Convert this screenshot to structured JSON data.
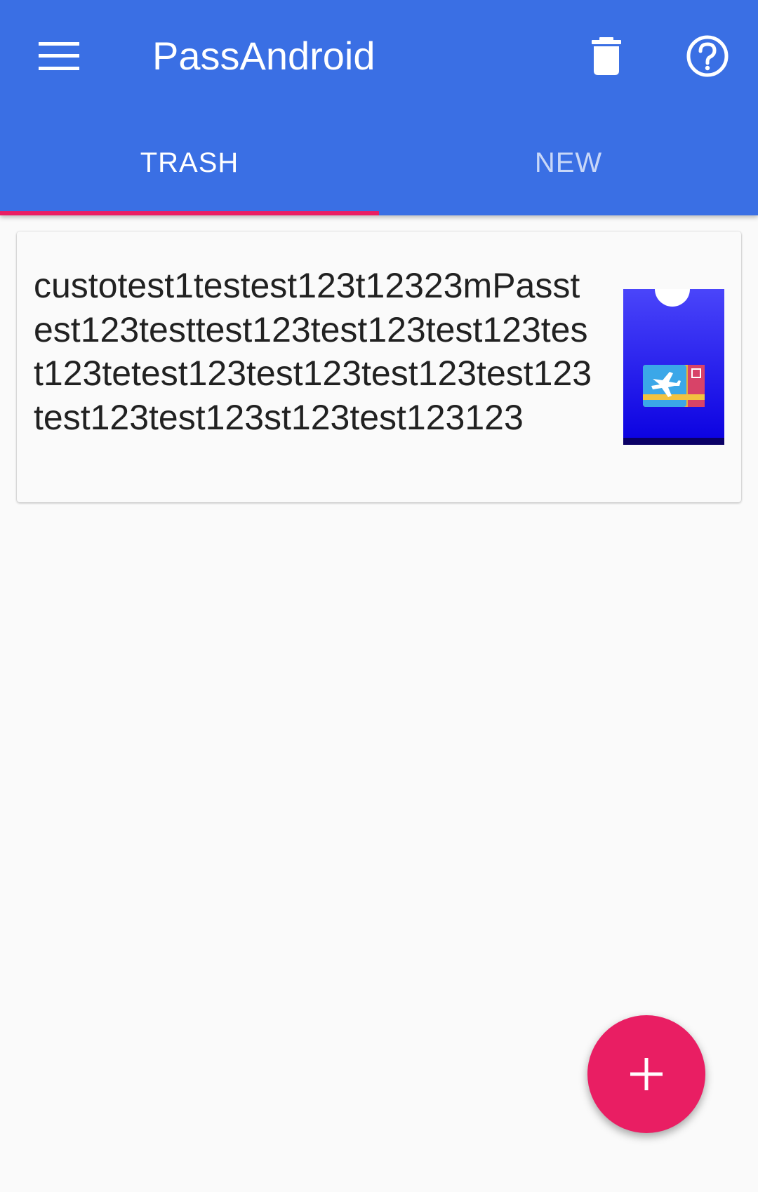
{
  "toolbar": {
    "title": "PassAndroid",
    "menu_icon": "menu-icon",
    "delete_icon": "trash-icon",
    "help_icon": "help-icon"
  },
  "tabs": [
    {
      "label": "TRASH",
      "active": true
    },
    {
      "label": "NEW",
      "active": false
    }
  ],
  "passes": [
    {
      "description": "custotest1testest123t12323mPasstest123testtest123test123test123test123tetest123test123test123test123test123test123st123test123123",
      "thumbnail_icon": "boarding-pass-icon"
    }
  ],
  "fab": {
    "icon": "plus-icon"
  },
  "colors": {
    "primary": "#3A6FE4",
    "accent": "#E91E63",
    "background": "#FAFAFA",
    "text": "#212121"
  }
}
